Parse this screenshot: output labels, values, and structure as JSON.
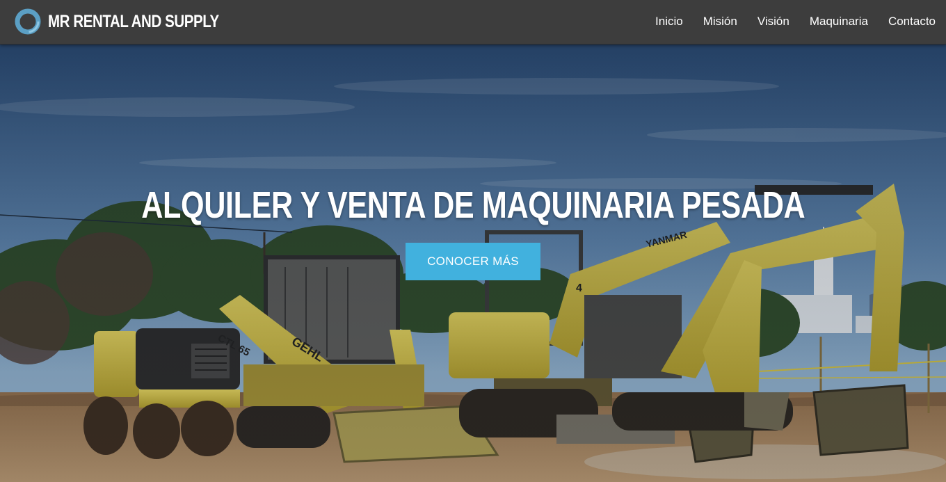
{
  "brand": {
    "name": "MR RENTAL AND SUPPLY",
    "logo_icon": "ring-logo-icon"
  },
  "nav": {
    "items": [
      {
        "label": "Inicio"
      },
      {
        "label": "Misión"
      },
      {
        "label": "Visión"
      },
      {
        "label": "Maquinaria"
      },
      {
        "label": "Contacto"
      }
    ]
  },
  "hero": {
    "title": "ALQUILER Y VENTA DE MAQUINARIA PESADA",
    "cta_label": "CONOCER MÁS",
    "background": "construction-site-heavy-machinery-photo",
    "machine_labels": {
      "compact_loader": "CTL 65",
      "loader_brand": "GEHL",
      "excavator_brand": "YANMAR",
      "excavator_number": "4"
    }
  },
  "colors": {
    "navbar_bg": "#3d3d3d",
    "cta_bg": "#41b1de",
    "text": "#ffffff",
    "logo_blue": "#5b9fc4"
  }
}
